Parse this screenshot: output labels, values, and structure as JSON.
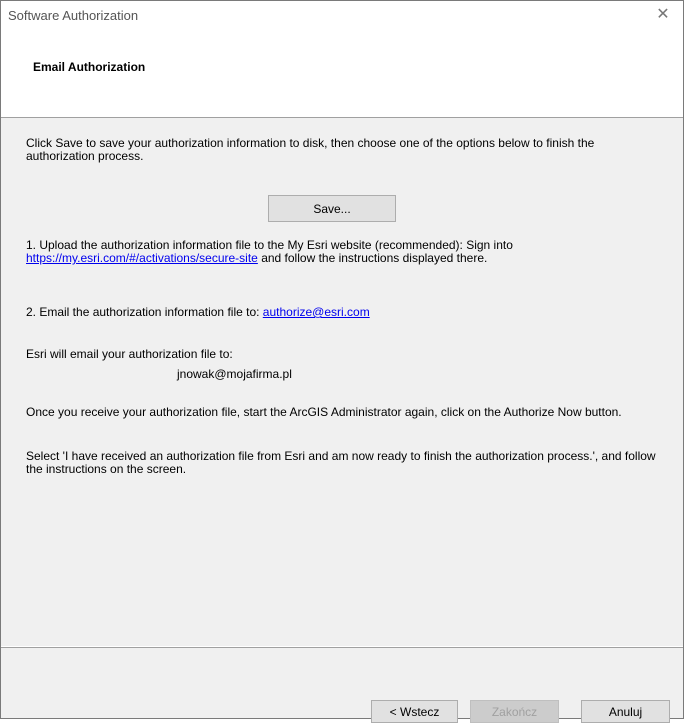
{
  "window": {
    "title": "Software Authorization",
    "close_glyph": "✕"
  },
  "header": {
    "title": "Email Authorization"
  },
  "content": {
    "intro": "Click Save to save your authorization information to disk, then choose one of the options below to finish the authorization process.",
    "save_button": "Save...",
    "option1_prefix": "1.  Upload the authorization information file to the My Esri website (recommended): Sign into ",
    "option1_link": "https://my.esri.com/#/activations/secure-site",
    "option1_suffix": " and follow the instructions displayed there.",
    "option2_prefix": "2.  Email the authorization information file to: ",
    "option2_link": "authorize@esri.com",
    "email_notice": "Esri will email your authorization file to:",
    "user_email": "jnowak@mojafirma.pl",
    "receive_text": "Once you receive your authorization file, start the ArcGIS Administrator again, click on the Authorize Now button.",
    "select_text": "Select 'I have received an authorization file from Esri and am now ready to finish the authorization process.', and follow the instructions on the screen."
  },
  "footer": {
    "back_button": "< Wstecz",
    "finish_button": "Zakończ",
    "cancel_button": "Anuluj"
  }
}
